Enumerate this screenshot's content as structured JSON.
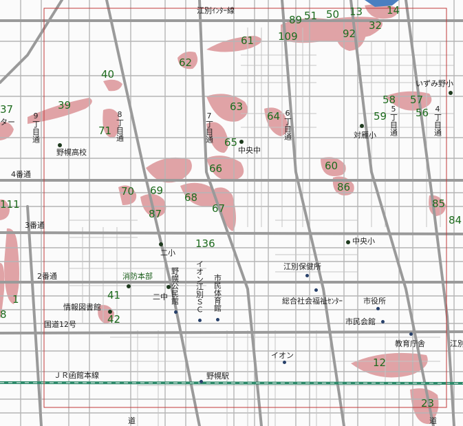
{
  "colors": {
    "background": "#fbfbfb",
    "road": "#a9a9a9",
    "major_road": "#9a9a9a",
    "railway": "#2d8a6a",
    "frame": "#c03a3a",
    "flood_zone": "#d98b8f",
    "zone_number": "#1d6b1d"
  },
  "roads": {
    "top": "江別ｲﾝﾀｰ線",
    "road_4": "4番通",
    "road_3": "3番通",
    "road_2": "2番通",
    "route12": "国道12号",
    "jr": "ＪＲ函館本線",
    "avenue_9": "9丁目通",
    "avenue_8": "8丁目通",
    "avenue_7": "7丁目通",
    "avenue_6": "6丁目通",
    "avenue_5": "5丁目通",
    "avenue_4": "4丁目通",
    "left_edge": "ター"
  },
  "places": {
    "nopporo_high": "野幌高校",
    "chuo_jr_high": "中央中",
    "taihei_elem": "対雁小",
    "izumino_elem": "いずみ野小",
    "chuo_elem": "中央小",
    "ni_elem": "二小",
    "fire_branch": "消防本部",
    "info_library": "情報図書館",
    "ni_jr_high": "二中",
    "nopporo_hall": "野幌公民館",
    "aeon_sc": "イオン江別ＳＣ",
    "city_gym": "市民体育館",
    "health_center": "江別保健所",
    "welfare_center": "総合社会福祉ｾﾝﾀｰ",
    "city_hall": "市役所",
    "civic_hall": "市民会館",
    "education_office": "教育庁舎",
    "aeon": "イオン",
    "nopporo_station": "野幌駅",
    "ebetsu_right": "江別",
    "bottom_left": "道",
    "bottom_right": "道"
  },
  "zones": [
    "89",
    "51",
    "50",
    "13",
    "14",
    "109",
    "32",
    "92",
    "61",
    "62",
    "40",
    "39",
    "71",
    "37",
    "63",
    "64",
    "58",
    "57",
    "56",
    "59",
    "65",
    "66",
    "60",
    "86",
    "70",
    "69",
    "68",
    "67",
    "87",
    "85",
    "84",
    "111",
    "136",
    "41",
    "42",
    "1",
    "8",
    "12",
    "23"
  ]
}
